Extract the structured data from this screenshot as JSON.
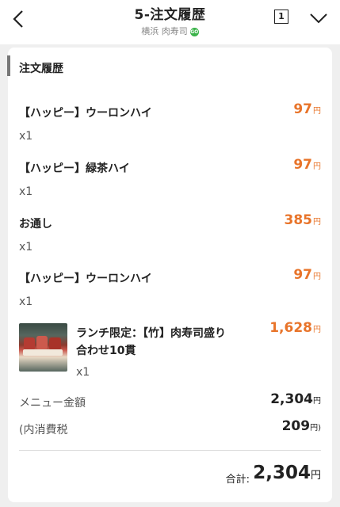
{
  "header": {
    "title": "5-注文履歴",
    "store_name": "横浜 肉寿司",
    "store_badge": "GO",
    "table_number": "1"
  },
  "section_title": "注文履歴",
  "currency_unit": "円",
  "items": [
    {
      "name": "【ハッピー】ウーロンハイ",
      "qty": "x1",
      "price": "97"
    },
    {
      "name": "【ハッピー】緑茶ハイ",
      "qty": "x1",
      "price": "97"
    },
    {
      "name": "お通し",
      "qty": "x1",
      "price": "385"
    },
    {
      "name": "【ハッピー】ウーロンハイ",
      "qty": "x1",
      "price": "97"
    },
    {
      "name_line1": "ランチ限定：【竹】肉寿司盛り",
      "name_line2": "合わせ10貫",
      "qty": "x1",
      "price": "1,628"
    }
  ],
  "summary": {
    "menu_total_label": "メニュー金額",
    "menu_total_value": "2,304",
    "tax_label": "(内消費税",
    "tax_value": "209",
    "tax_unit": "円)",
    "grand_total_label": "合計:",
    "grand_total_value": "2,304"
  },
  "colors": {
    "accent": "#e8742a",
    "bar": "#777777"
  }
}
